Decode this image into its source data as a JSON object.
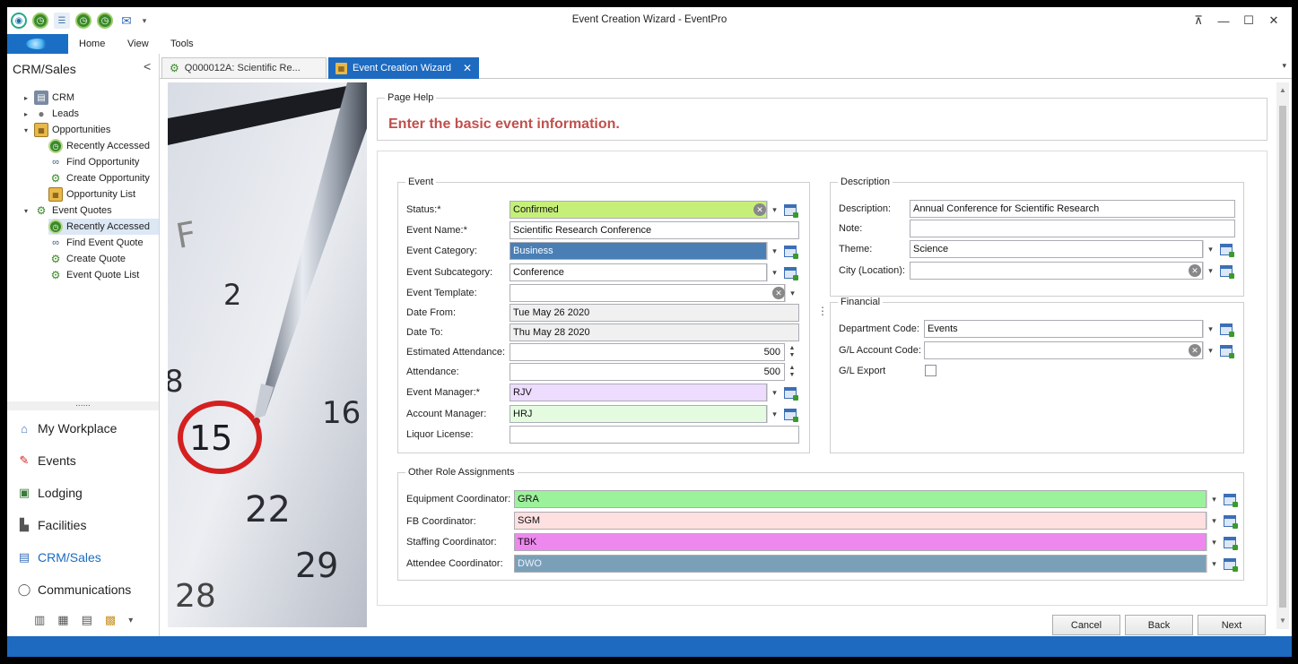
{
  "window": {
    "title": "Event Creation Wizard - EventPro"
  },
  "quick_access": {
    "dropdown_glyph": "▾"
  },
  "window_controls": {
    "restore_label": "⊼",
    "minimize_label": "—",
    "maximize_label": "☐",
    "close_label": "✕"
  },
  "menu": {
    "home": "Home",
    "view": "View",
    "tools": "Tools"
  },
  "sidebar": {
    "title": "CRM/Sales",
    "collapse_glyph": "<",
    "tree": [
      {
        "label": "CRM",
        "level": 0,
        "expander": "▸",
        "icon": "crm-icon"
      },
      {
        "label": "Leads",
        "level": 0,
        "expander": "▸",
        "icon": "person-icon"
      },
      {
        "label": "Opportunities",
        "level": 0,
        "expander": "▾",
        "icon": "folder-icon"
      },
      {
        "label": "Recently Accessed",
        "level": 1,
        "icon": "clock-icon"
      },
      {
        "label": "Find Opportunity",
        "level": 1,
        "icon": "binoculars-icon"
      },
      {
        "label": "Create Opportunity",
        "level": 1,
        "icon": "gear-icon"
      },
      {
        "label": "Opportunity List",
        "level": 1,
        "icon": "folder-icon"
      },
      {
        "label": "Event Quotes",
        "level": 0,
        "expander": "▾",
        "icon": "gear-icon"
      },
      {
        "label": "Recently Accessed",
        "level": 1,
        "icon": "clock-icon",
        "selected": true
      },
      {
        "label": "Find Event Quote",
        "level": 1,
        "icon": "binoculars-icon"
      },
      {
        "label": "Create Quote",
        "level": 1,
        "icon": "gear-icon"
      },
      {
        "label": "Event Quote List",
        "level": 1,
        "icon": "gear-icon"
      }
    ],
    "splitter": "......",
    "nav": [
      {
        "label": "My Workplace",
        "icon": "home-icon"
      },
      {
        "label": "Events",
        "icon": "pushpin-icon"
      },
      {
        "label": "Lodging",
        "icon": "lodging-icon"
      },
      {
        "label": "Facilities",
        "icon": "facilities-icon"
      },
      {
        "label": "CRM/Sales",
        "icon": "crm-sales-icon",
        "active": true
      },
      {
        "label": "Communications",
        "icon": "speech-bubble-icon"
      }
    ]
  },
  "tabs": [
    {
      "label": "Q000012A: Scientific Re...",
      "active": false
    },
    {
      "label": "Event Creation Wizard",
      "active": true,
      "close": "✕"
    }
  ],
  "page_help": {
    "title": "Page Help",
    "text": "Enter the basic event information."
  },
  "event_group": {
    "title": "Event",
    "status_label": "Status:*",
    "status_value": "Confirmed",
    "name_label": "Event Name:*",
    "name_value": "Scientific Research Conference",
    "category_label": "Event Category:",
    "category_value": "Business",
    "subcategory_label": "Event Subcategory:",
    "subcategory_value": "Conference",
    "template_label": "Event Template:",
    "template_value": "",
    "date_from_label": "Date From:",
    "date_from_value": "Tue May 26 2020",
    "date_to_label": "Date To:",
    "date_to_value": "Thu May 28 2020",
    "est_attendance_label": "Estimated Attendance:",
    "est_attendance_value": "500",
    "attendance_label": "Attendance:",
    "attendance_value": "500",
    "manager_label": "Event Manager:*",
    "manager_value": "RJV",
    "account_manager_label": "Account Manager:",
    "account_manager_value": "HRJ",
    "liquor_label": "Liquor License:",
    "liquor_value": ""
  },
  "description_group": {
    "title": "Description",
    "description_label": "Description:",
    "description_value": "Annual Conference for Scientific Research",
    "note_label": "Note:",
    "note_value": "",
    "theme_label": "Theme:",
    "theme_value": "Science",
    "city_label": "City (Location):",
    "city_value": ""
  },
  "financial_group": {
    "title": "Financial",
    "dept_label": "Department Code:",
    "dept_value": "Events",
    "gl_label": "G/L Account Code:",
    "gl_value": "",
    "export_label": "G/L Export",
    "export_checked": false
  },
  "roles_group": {
    "title": "Other Role Assignments",
    "equipment_label": "Equipment Coordinator:",
    "equipment_value": "GRA",
    "fb_label": "FB Coordinator:",
    "fb_value": "SGM",
    "staffing_label": "Staffing Coordinator:",
    "staffing_value": "TBK",
    "attendee_label": "Attendee Coordinator:",
    "attendee_value": "DWO"
  },
  "buttons": {
    "cancel": "Cancel",
    "back": "Back",
    "next": "Next"
  },
  "colors": {
    "accent": "#1d6ac0",
    "status_fill": "#c6ef7a",
    "category_fill": "#4a7fb5",
    "manager_fill": "#eedcff",
    "account_manager_fill": "#e4fbe0",
    "equipment_fill": "#9cf29a",
    "fb_fill": "#ffe0e0",
    "staffing_fill": "#ee88ee",
    "attendee_fill": "#7aa0b8",
    "help_text": "#c0504d"
  },
  "glyphs": {
    "dropdown": "▾",
    "clear": "✕",
    "spin_up": "▲",
    "spin_down": "▼",
    "grip": "⋮"
  }
}
